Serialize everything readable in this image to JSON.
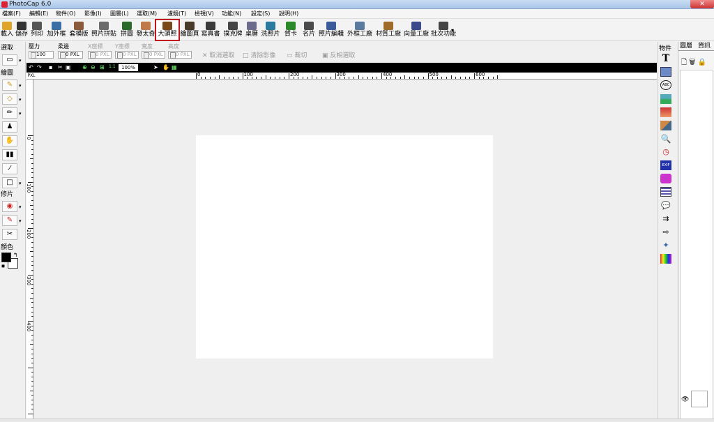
{
  "window": {
    "title": "PhotoCap 6.0"
  },
  "menubar": [
    "檔案(F)",
    "編輯(E)",
    "物件(O)",
    "影像(I)",
    "圖層(L)",
    "選取(M)",
    "濾鏡(T)",
    "檢視(V)",
    "功能(N)",
    "設定(S)",
    "說明(H)"
  ],
  "toolbar": [
    {
      "label": "載入",
      "icon": "open-folder-icon",
      "color": "#e0a528"
    },
    {
      "label": "儲存",
      "icon": "save-icon",
      "color": "#333333"
    },
    {
      "label": "列印",
      "icon": "print-icon",
      "color": "#555555"
    },
    {
      "label": "加外框",
      "icon": "frame-icon",
      "color": "#3a6ea5"
    },
    {
      "label": "套模版",
      "icon": "template-icon",
      "color": "#8a5a3a"
    },
    {
      "label": "照片拼貼",
      "icon": "collage-icon",
      "color": "#6b6b6b"
    },
    {
      "label": "拼圖",
      "icon": "puzzle-icon",
      "color": "#2a6a2a"
    },
    {
      "label": "發太奇",
      "icon": "face-icon",
      "color": "#c07a4a"
    },
    {
      "label": "大頭照",
      "icon": "grid-photo-icon",
      "color": "#7a4a1a"
    },
    {
      "label": "繪圖頁",
      "icon": "drawing-page-icon",
      "color": "#4a3a2a"
    },
    {
      "label": "寫真書",
      "icon": "photobook-icon",
      "color": "#3a3a3a"
    },
    {
      "label": "撲克牌",
      "icon": "poker-icon",
      "color": "#444444"
    },
    {
      "label": "桌曆",
      "icon": "calendar-icon",
      "color": "#6a6a8a"
    },
    {
      "label": "洗照片",
      "icon": "print-photo-icon",
      "color": "#2a7aa0"
    },
    {
      "label": "賀卡",
      "icon": "greeting-card-icon",
      "color": "#2a8a2a"
    },
    {
      "label": "名片",
      "icon": "business-card-icon",
      "color": "#4a4a4a"
    },
    {
      "label": "照片編輯",
      "icon": "photo-edit-icon",
      "color": "#3a5a9a"
    },
    {
      "label": "外框工廠",
      "icon": "frame-factory-icon",
      "color": "#5a7aa0"
    },
    {
      "label": "材質工廠",
      "icon": "texture-factory-icon",
      "color": "#a06a2a"
    },
    {
      "label": "向量工廠",
      "icon": "vector-factory-icon",
      "color": "#3a4a8a"
    },
    {
      "label": "批次功能",
      "icon": "batch-icon",
      "color": "#444444"
    }
  ],
  "options": {
    "pressure": {
      "label": "壓力",
      "value": "100"
    },
    "feather": {
      "label": "柔邊",
      "value": "0"
    },
    "x": {
      "label": "X座標",
      "value": "0"
    },
    "y": {
      "label": "Y座標",
      "value": "0"
    },
    "width": {
      "label": "寬度",
      "value": "0"
    },
    "height": {
      "label": "高度",
      "value": "0"
    },
    "unit": "PXL",
    "actions": [
      "取消選取",
      "清除影像",
      "裁切",
      "反相選取"
    ]
  },
  "left_panel": {
    "select": "選取",
    "draw": "繪圖",
    "retouch": "修片",
    "color": "顏色",
    "foreground": "#000000",
    "background": "#ffffff"
  },
  "viewbar": {
    "zoom": "100%"
  },
  "ruler": {
    "corner": "PXL",
    "h_labels": [
      "0",
      "100",
      "200",
      "300",
      "400",
      "500",
      "600"
    ],
    "v_labels": [
      "0",
      "100",
      "200",
      "300",
      "400"
    ]
  },
  "objects_panel": {
    "title": "物件"
  },
  "layers_panel": {
    "tabs": [
      "圖層",
      "資訊"
    ]
  }
}
